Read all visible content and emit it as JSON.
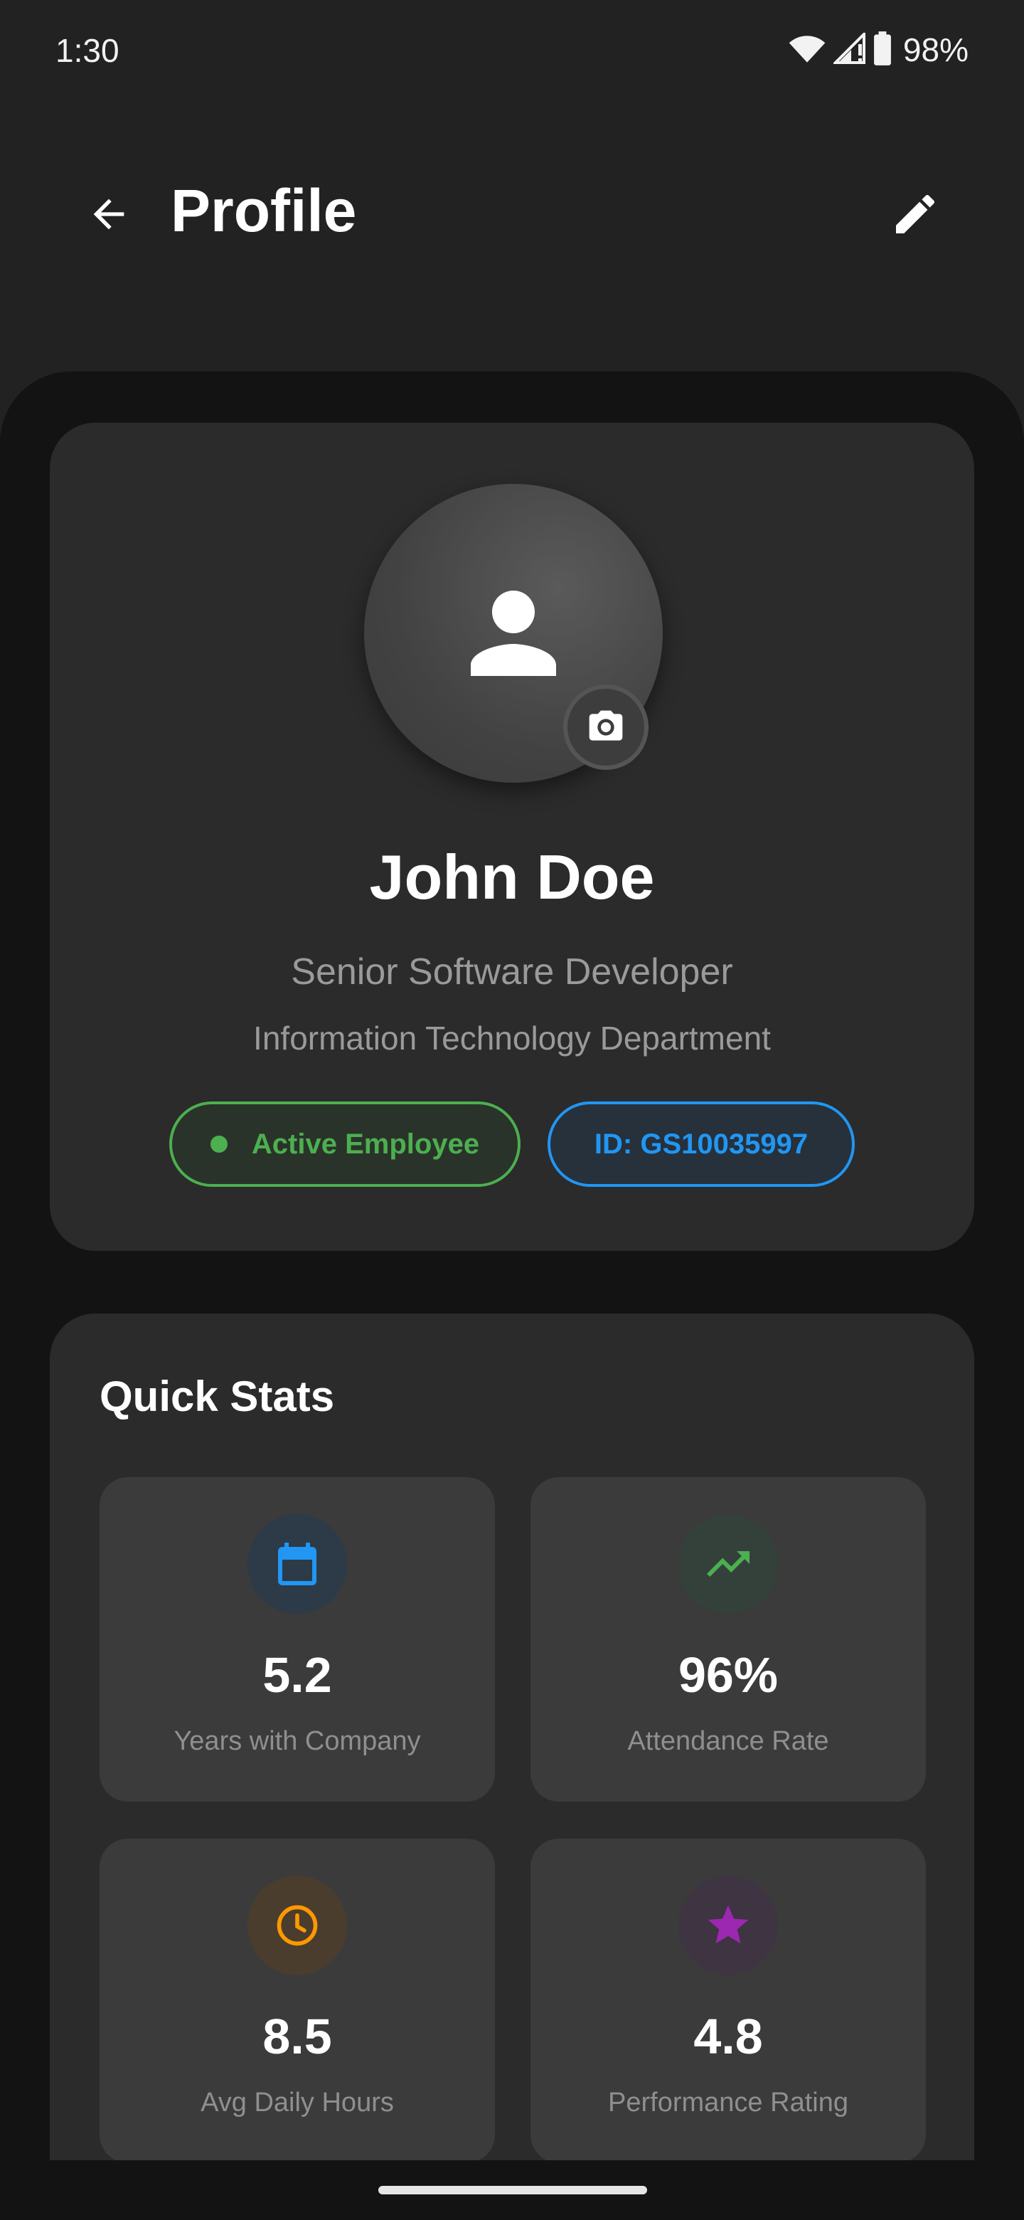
{
  "status_bar": {
    "time": "1:30",
    "battery_percent": "98%",
    "icons": [
      "wifi-icon",
      "signal-icon",
      "battery-icon"
    ]
  },
  "app_bar": {
    "title": "Profile",
    "back_icon": "arrow-back-icon",
    "edit_icon": "pencil-icon"
  },
  "profile": {
    "name": "John Doe",
    "role": "Senior Software Developer",
    "department": "Information Technology Department",
    "avatar_icon": "person-icon",
    "camera_icon": "camera-icon",
    "status_badge": "Active Employee",
    "employee_id": "ID: GS10035997"
  },
  "quick_stats": {
    "title": "Quick Stats",
    "items": [
      {
        "value": "5.2",
        "label": "Years with Company",
        "icon": "calendar-icon",
        "color": "#2196f3"
      },
      {
        "value": "96%",
        "label": "Attendance Rate",
        "icon": "trending-up-icon",
        "color": "#4caf50"
      },
      {
        "value": "8.5",
        "label": "Avg Daily Hours",
        "icon": "clock-icon",
        "color": "#ff9800"
      },
      {
        "value": "4.8",
        "label": "Performance Rating",
        "icon": "star-icon",
        "color": "#9c27b0"
      }
    ]
  },
  "colors": {
    "background": "#222222",
    "sheet": "#131313",
    "card": "#2b2b2b",
    "tile": "#3b3b3b",
    "active_green": "#4caf50",
    "id_blue": "#2196f3"
  }
}
